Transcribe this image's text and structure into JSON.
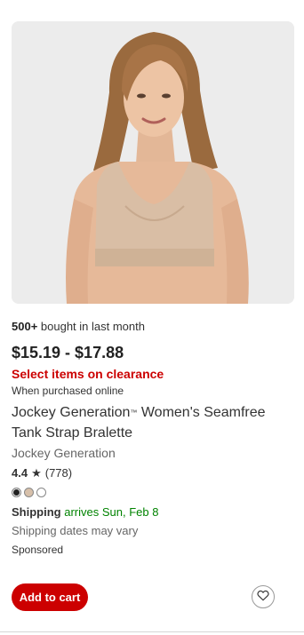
{
  "product": {
    "bought_count": "500+",
    "bought_suffix": " bought in last month",
    "price": "$15.19 - $17.88",
    "clearance": "Select items on clearance",
    "purchase_note": "When purchased online",
    "title_part1": "Jockey Generation",
    "title_tm": "™",
    "title_part2": " Women's Seamfree Tank Strap Bralette",
    "brand": "Jockey Generation",
    "rating": "4.4",
    "rating_star": "★",
    "review_count": "(778)",
    "swatches": [
      {
        "color": "#222222",
        "selected": true
      },
      {
        "color": "#d7c0aa",
        "selected": false
      },
      {
        "color": "#ffffff",
        "selected": false
      }
    ],
    "shipping_label": "Shipping",
    "shipping_arrival": " arrives Sun, Feb 8",
    "shipping_note": "Shipping dates may vary",
    "sponsored": "Sponsored"
  },
  "actions": {
    "add_to_cart": "Add to cart",
    "favorite_icon": "heart-icon"
  },
  "colors": {
    "accent": "#cc0000",
    "shipping_green": "#008300"
  }
}
